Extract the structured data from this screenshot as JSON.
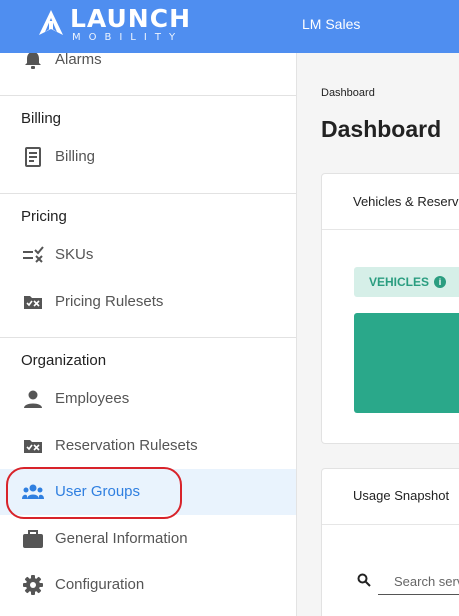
{
  "header": {
    "logo_word": "LAUNCH",
    "logo_sub": "MOBILITY",
    "org_name": "LM Sales",
    "color": "#4f8ef0"
  },
  "sidebar": {
    "partial_item": {
      "label": "Alarms",
      "icon": "alarm-icon"
    },
    "sections": [
      {
        "title": "Billing",
        "items": [
          {
            "label": "Billing",
            "icon": "invoice-icon"
          }
        ]
      },
      {
        "title": "Pricing",
        "items": [
          {
            "label": "SKUs",
            "icon": "sku-list-icon"
          },
          {
            "label": "Pricing Rulesets",
            "icon": "ruleset-icon"
          }
        ]
      },
      {
        "title": "Organization",
        "items": [
          {
            "label": "Employees",
            "icon": "person-icon"
          },
          {
            "label": "Reservation Rulesets",
            "icon": "ruleset-icon"
          },
          {
            "label": "User Groups",
            "icon": "user-group-icon",
            "active": true,
            "highlighted": true
          },
          {
            "label": "General Information",
            "icon": "briefcase-icon"
          },
          {
            "label": "Configuration",
            "icon": "gear-icon"
          }
        ]
      }
    ],
    "active_color": "#2f7fe0",
    "highlight_color": "#d8232a"
  },
  "main": {
    "breadcrumb": "Dashboard",
    "title": "Dashboard",
    "card1": {
      "title": "Vehicles & Reservations",
      "badge": "VEHICLES",
      "badge_icon": "info-icon",
      "bar_color": "#2aa88a"
    },
    "card2": {
      "title": "Usage Snapshot",
      "search_placeholder": "Search service"
    }
  }
}
